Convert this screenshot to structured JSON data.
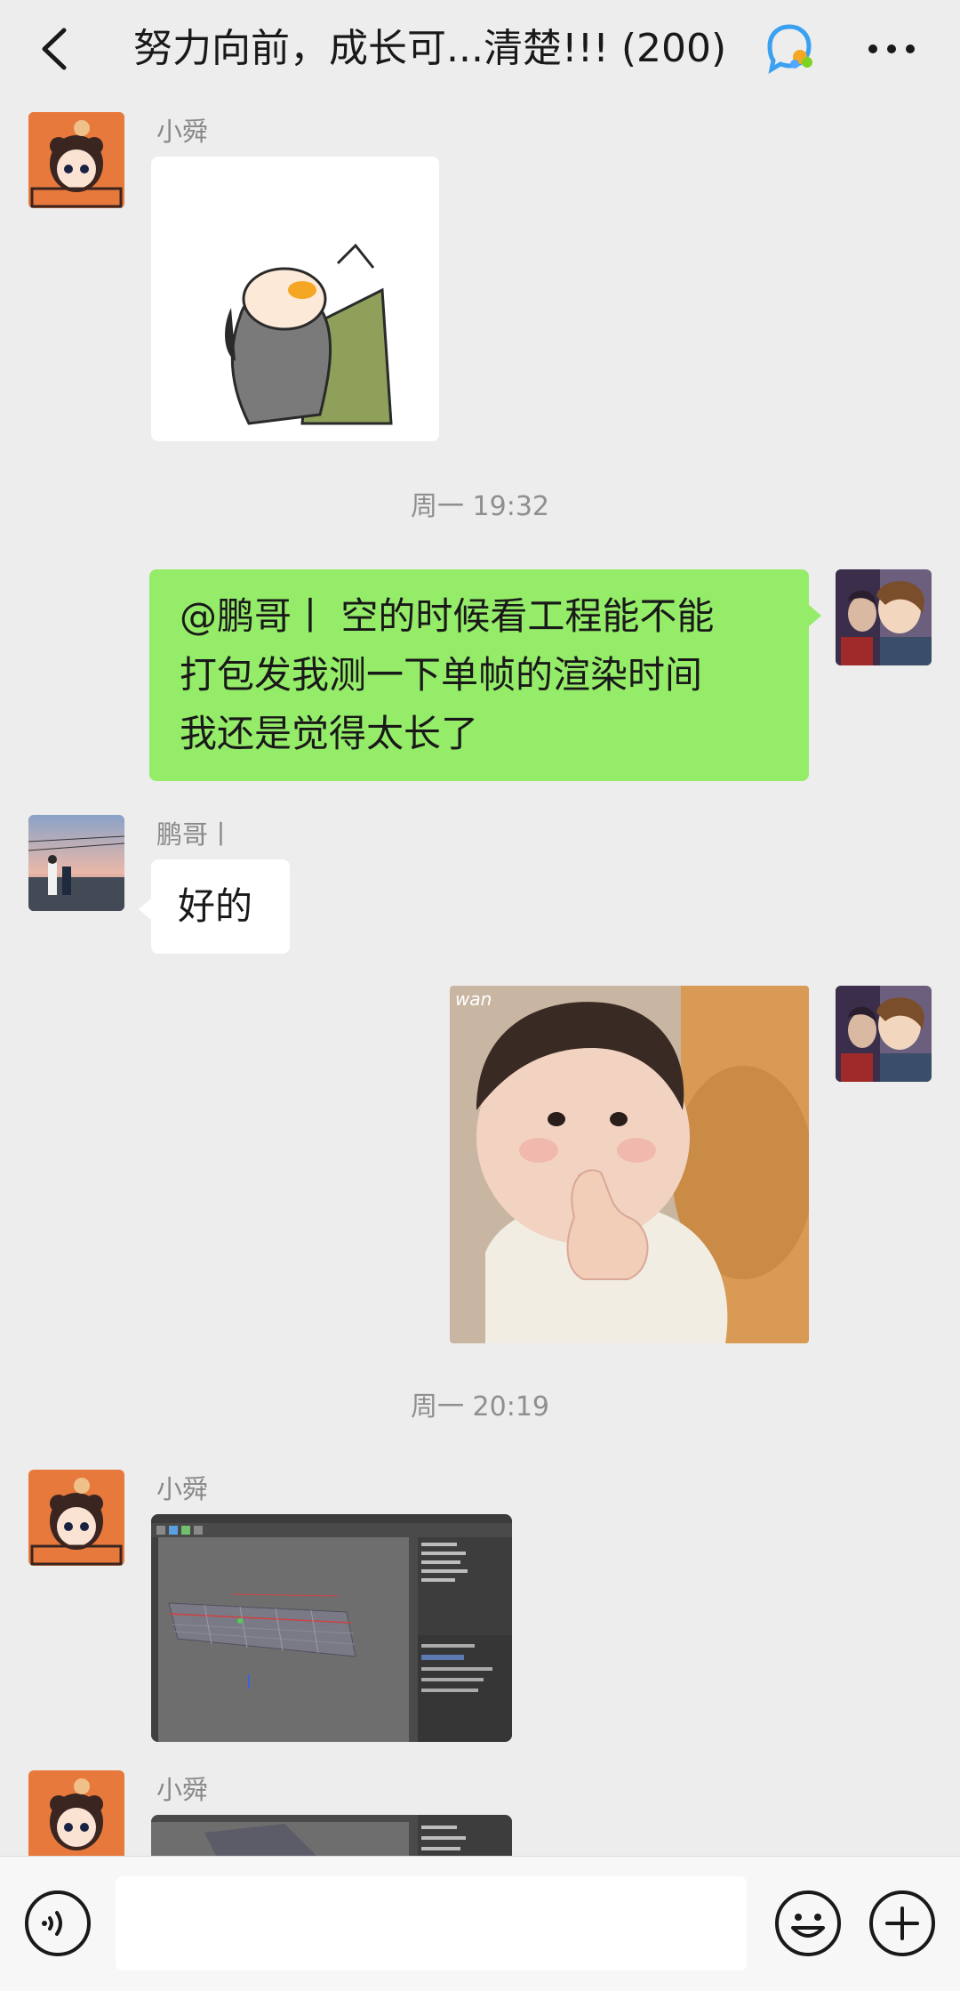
{
  "header": {
    "title": "努力向前，成长可...清楚!!! (200)"
  },
  "messages": [
    {
      "type": "image",
      "sender": "小舜",
      "content": "sticker-man-eating"
    },
    {
      "type": "time",
      "text": "周一 19:32"
    },
    {
      "type": "text",
      "sender": "me",
      "lines": [
        "@鹏哥丨  空的时候看工程能不能",
        "打包发我测一下单帧的渲染时间",
        "我还是觉得太长了"
      ]
    },
    {
      "type": "text",
      "sender": "鹏哥丨",
      "text": "好的"
    },
    {
      "type": "image",
      "sender": "me",
      "content": "sticker-baby-thumbs-up",
      "watermark": "wan"
    },
    {
      "type": "time",
      "text": "周一 20:19"
    },
    {
      "type": "image",
      "sender": "小舜",
      "content": "screenshot-3d-software"
    },
    {
      "type": "image",
      "sender": "小舜",
      "content": "screenshot-3d-software-partial"
    }
  ],
  "colors": {
    "bg": "#ededed",
    "bubble_me": "#95ec69",
    "bubble_other": "#ffffff"
  },
  "input": {
    "value": ""
  }
}
